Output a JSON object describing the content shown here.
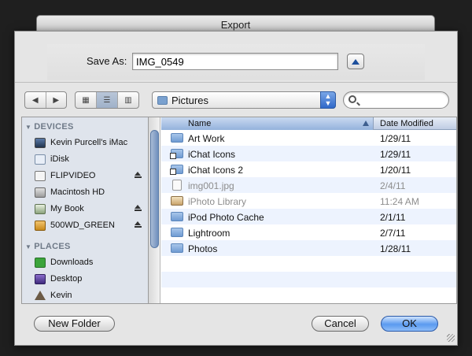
{
  "window": {
    "title": "Export"
  },
  "save": {
    "label": "Save As:",
    "value": "IMG_0549"
  },
  "location": {
    "current": "Pictures"
  },
  "search": {
    "placeholder": ""
  },
  "sidebar": {
    "devices_heading": "DEVICES",
    "devices": [
      {
        "label": "Kevin Purcell's iMac",
        "icon": "imac-icon",
        "eject": false
      },
      {
        "label": "iDisk",
        "icon": "idisk-icon",
        "eject": false
      },
      {
        "label": "FLIPVIDEO",
        "icon": "drive-icon",
        "eject": true
      },
      {
        "label": "Macintosh HD",
        "icon": "hard-disk-icon",
        "eject": false
      },
      {
        "label": "My Book",
        "icon": "external-drive-icon",
        "eject": true
      },
      {
        "label": "500WD_GREEN",
        "icon": "external-drive-icon",
        "eject": true
      }
    ],
    "places_heading": "PLACES",
    "places": [
      {
        "label": "Downloads",
        "icon": "downloads-icon"
      },
      {
        "label": "Desktop",
        "icon": "desktop-icon"
      },
      {
        "label": "Kevin",
        "icon": "home-icon"
      }
    ]
  },
  "list": {
    "columns": {
      "name": "Name",
      "date": "Date Modified"
    },
    "rows": [
      {
        "name": "Art Work",
        "date": "1/29/11",
        "kind": "folder",
        "dim": false
      },
      {
        "name": "iChat Icons",
        "date": "1/29/11",
        "kind": "alias",
        "dim": false
      },
      {
        "name": "iChat Icons 2",
        "date": "1/20/11",
        "kind": "alias",
        "dim": false
      },
      {
        "name": "img001.jpg",
        "date": "2/4/11",
        "kind": "file",
        "dim": true
      },
      {
        "name": "iPhoto Library",
        "date": "11:24 AM",
        "kind": "library",
        "dim": true
      },
      {
        "name": "iPod Photo Cache",
        "date": "2/1/11",
        "kind": "folder",
        "dim": false
      },
      {
        "name": "Lightroom",
        "date": "2/7/11",
        "kind": "folder",
        "dim": false
      },
      {
        "name": "Photos",
        "date": "1/28/11",
        "kind": "folder",
        "dim": false
      }
    ]
  },
  "buttons": {
    "new_folder": "New Folder",
    "cancel": "Cancel",
    "ok": "OK"
  },
  "colors": {
    "accent": "#5a9af0",
    "sidebar_bg": "#dfe4ec",
    "row_alt": "#edf3fe"
  }
}
